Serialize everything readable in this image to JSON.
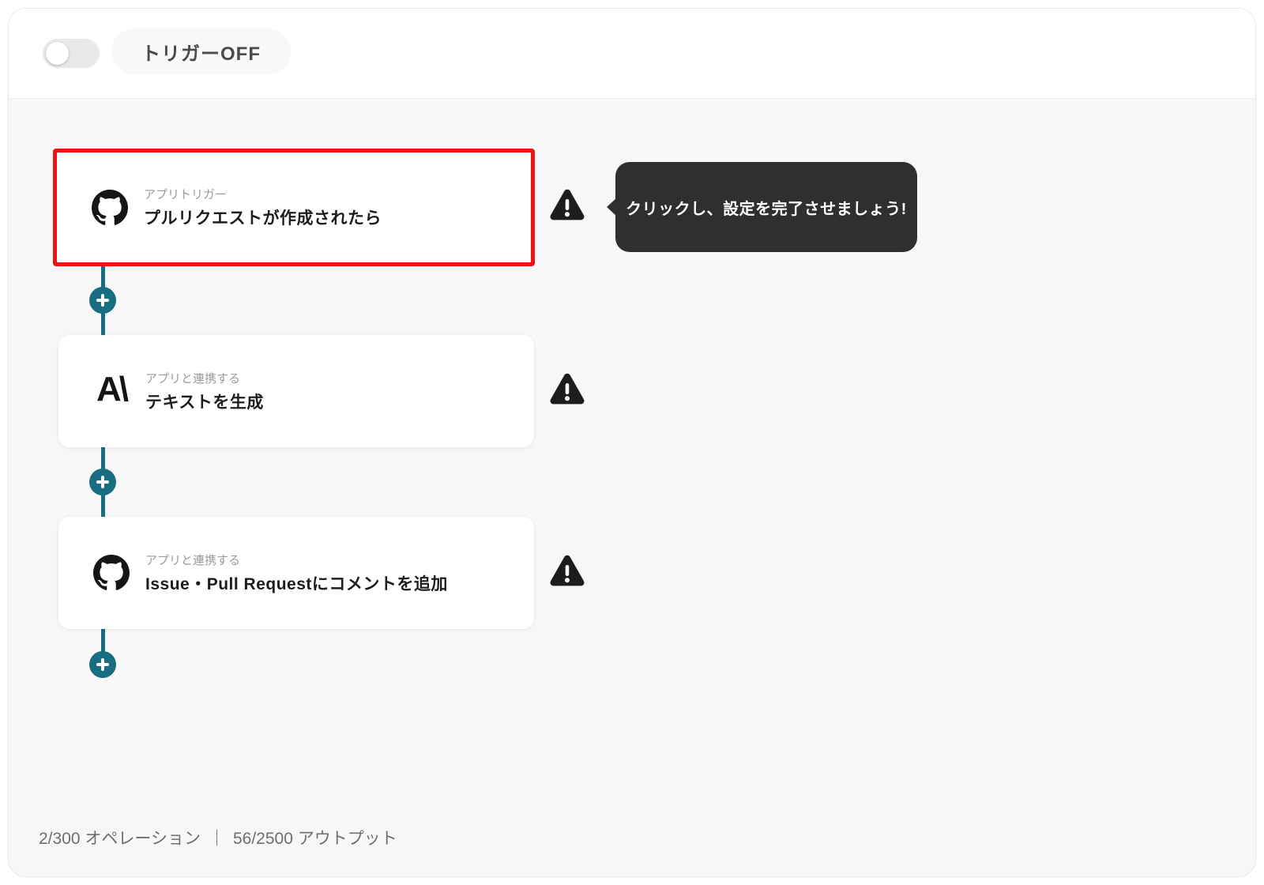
{
  "header": {
    "trigger_toggle_state": "off",
    "trigger_badge_label": "トリガーOFF"
  },
  "workflow": {
    "nodes": [
      {
        "app_icon": "github-icon",
        "label": "アプリトリガー",
        "title": "プルリクエストが作成されたら",
        "warning": true,
        "highlighted": true
      },
      {
        "app_icon": "anthropic-icon",
        "label": "アプリと連携する",
        "title": "テキストを生成",
        "warning": true,
        "highlighted": false
      },
      {
        "app_icon": "github-icon",
        "label": "アプリと連携する",
        "title": "Issue・Pull Requestにコメントを追加",
        "warning": true,
        "highlighted": false
      }
    ],
    "tooltip": {
      "text": "クリックし、設定を完了させましょう!"
    },
    "icons": {
      "anthropic_glyph": "A\\",
      "plus": "plus-icon",
      "warning": "warning-icon"
    }
  },
  "footer": {
    "operations": "2/300 オペレーション",
    "divider": "｜",
    "outputs": "56/2500 アウトプット"
  },
  "colors": {
    "accent_teal": "#186d83",
    "highlight_red": "#ee1212",
    "tooltip_bg": "#2f2f2f",
    "warning_black": "#1d1d1d",
    "canvas_bg": "#f7f7f7"
  }
}
